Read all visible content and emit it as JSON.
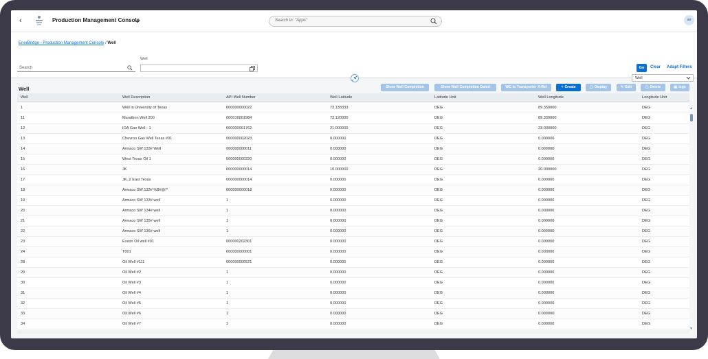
{
  "shell": {
    "back": "‹",
    "title": "Production Management Console",
    "search_placeholder": "Search In: \"Apps\"",
    "avatar": "as"
  },
  "breadcrumb": {
    "root": "EnerBridge - Production Management Console",
    "sep": " / ",
    "current": "Well"
  },
  "filters": {
    "search_placeholder": "Search",
    "well_label": "Well",
    "well_value": "",
    "go": "Go",
    "clear": "Clear",
    "adapt": "Adapt Filters"
  },
  "variant": "Well",
  "table": {
    "title": "Well",
    "buttons": [
      {
        "label": "Show Well Completion",
        "icon": ""
      },
      {
        "label": "Show Well Completion Dated",
        "icon": ""
      },
      {
        "label": "WC to Transporter X-Ref",
        "icon": ""
      },
      {
        "label": "Create",
        "icon": "+"
      },
      {
        "label": "Display",
        "icon": "▢"
      },
      {
        "label": "Edit",
        "icon": "✎"
      },
      {
        "label": "Delete",
        "icon": "▢"
      },
      {
        "label": "logs",
        "icon": "▤"
      }
    ],
    "columns": [
      "Well",
      "Well Description",
      "API Well Number",
      "Well Latitude",
      "Latitude Unit",
      "Well Longitude",
      "Longitude Unit"
    ],
    "rows": [
      [
        "1",
        "Well in University of Texas",
        "000000000022",
        "72.133333",
        "DEG",
        "89.350000",
        "DEG"
      ],
      [
        "11",
        "Marathon Well 200",
        "000016001984",
        "72.120000",
        "DEG",
        "89.330000",
        "DEG"
      ],
      [
        "12",
        "IOA Gas Well - 1",
        "000000001762",
        "21.000000",
        "DEG",
        "23.000000",
        "DEG"
      ],
      [
        "13",
        "Chevron Gas Well Texas #01",
        "000000002023",
        "0.000000",
        "DEG",
        "0.000000",
        "DEG"
      ],
      [
        "14",
        "Armaco SW 133# Well",
        "000000000011",
        "0.000000",
        "DEG",
        "0.000000",
        "DEG"
      ],
      [
        "15",
        "West Texas Oil 1",
        "000000000220",
        "0.000000",
        "DEG",
        "0.000000",
        "DEG"
      ],
      [
        "16",
        "JK",
        "000000000014",
        "10.000000",
        "DEG",
        "20.000000",
        "DEG"
      ],
      [
        "17",
        "JK_2 East Texas",
        "000000000014",
        "0.000000",
        "DEG",
        "0.000000",
        "DEG"
      ],
      [
        "18",
        "Armaco SW 133# %$#@!*",
        "000000000018",
        "0.000000",
        "DEG",
        "0.000000",
        "DEG"
      ],
      [
        "19",
        "Armaco SW 133# well",
        "1",
        "0.000000",
        "DEG",
        "0.000000",
        "DEG"
      ],
      [
        "20",
        "Armaco SW 134# well",
        "1",
        "0.000000",
        "DEG",
        "0.000000",
        "DEG"
      ],
      [
        "21",
        "Armaco SW 135# well",
        "1",
        "0.000000",
        "DEG",
        "0.000000",
        "DEG"
      ],
      [
        "22",
        "Armaco SW 136# well",
        "1",
        "0.000000",
        "DEG",
        "0.000000",
        "DEG"
      ],
      [
        "23",
        "Exxon Oil well #01",
        "000000202301",
        "0.000000",
        "DEG",
        "0.000000",
        "DEG"
      ],
      [
        "24",
        "T001",
        "000000000001",
        "0.000000",
        "DEG",
        "0.000000",
        "DEG"
      ],
      [
        "28",
        "Oil Well #111",
        "000000000521",
        "0.000000",
        "DEG",
        "0.000000",
        "DEG"
      ],
      [
        "29",
        "Oil Well #2",
        "1",
        "0.000000",
        "DEG",
        "0.000000",
        "DEG"
      ],
      [
        "30",
        "Oil Well #3",
        "1",
        "0.000000",
        "DEG",
        "0.000000",
        "DEG"
      ],
      [
        "31",
        "Oil Well #4",
        "1",
        "0.000000",
        "DEG",
        "0.000000",
        "DEG"
      ],
      [
        "32",
        "Oil Well #5",
        "1",
        "0.000000",
        "DEG",
        "0.000000",
        "DEG"
      ],
      [
        "33",
        "Oil Well #6",
        "1",
        "0.000000",
        "DEG",
        "0.000000",
        "DEG"
      ],
      [
        "34",
        "Oil Well #7",
        "1",
        "0.000000",
        "DEG",
        "0.000000",
        "DEG"
      ]
    ]
  }
}
